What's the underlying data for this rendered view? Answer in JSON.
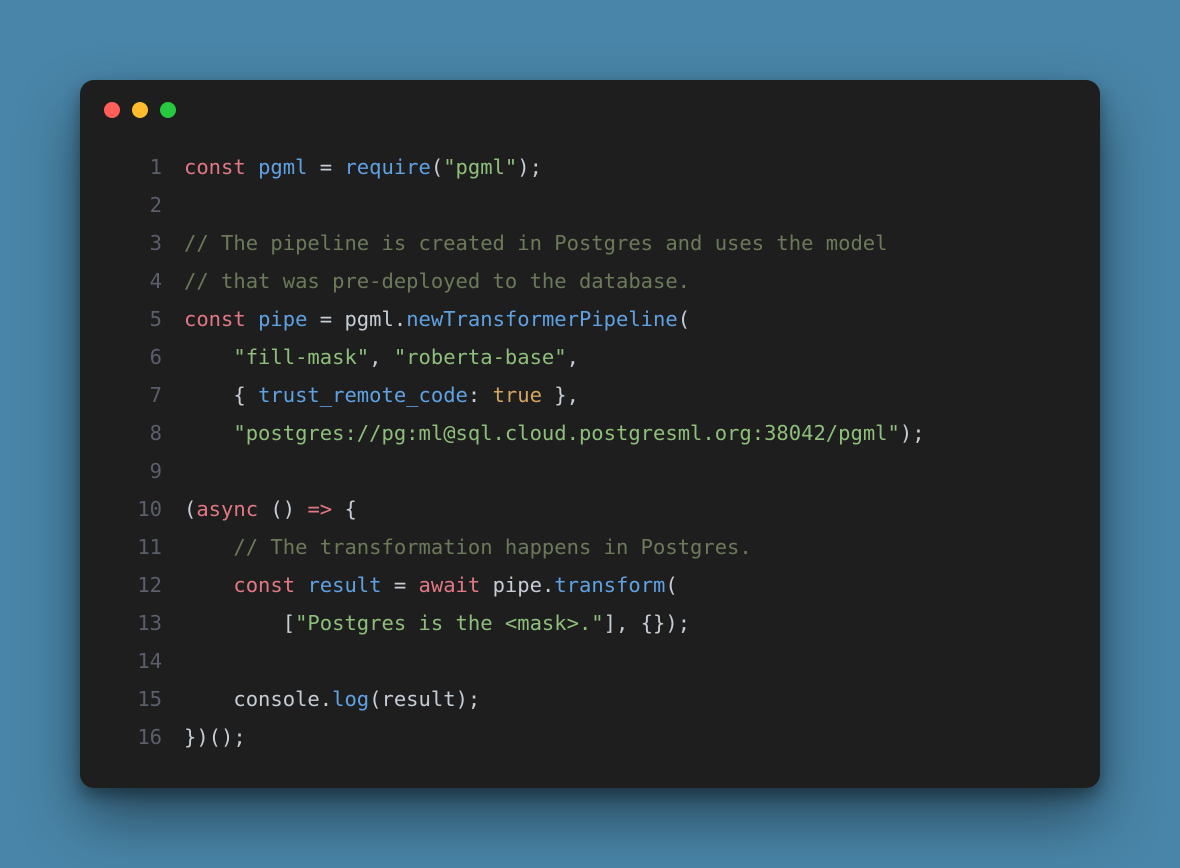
{
  "window": {
    "traffic_lights": [
      "close",
      "minimize",
      "zoom"
    ]
  },
  "code": {
    "lines": [
      {
        "n": "1",
        "tokens": [
          {
            "c": "tok-keyword",
            "t": "const"
          },
          {
            "c": "tok-default",
            "t": " "
          },
          {
            "c": "tok-ident",
            "t": "pgml"
          },
          {
            "c": "tok-default",
            "t": " "
          },
          {
            "c": "tok-punct",
            "t": "="
          },
          {
            "c": "tok-default",
            "t": " "
          },
          {
            "c": "tok-require",
            "t": "require"
          },
          {
            "c": "tok-punct",
            "t": "("
          },
          {
            "c": "tok-string",
            "t": "\"pgml\""
          },
          {
            "c": "tok-punct",
            "t": ");"
          }
        ]
      },
      {
        "n": "2",
        "tokens": []
      },
      {
        "n": "3",
        "tokens": [
          {
            "c": "tok-comment",
            "t": "// The pipeline is created in Postgres and uses the model"
          }
        ]
      },
      {
        "n": "4",
        "tokens": [
          {
            "c": "tok-comment",
            "t": "// that was pre-deployed to the database."
          }
        ]
      },
      {
        "n": "5",
        "tokens": [
          {
            "c": "tok-keyword",
            "t": "const"
          },
          {
            "c": "tok-default",
            "t": " "
          },
          {
            "c": "tok-ident",
            "t": "pipe"
          },
          {
            "c": "tok-default",
            "t": " "
          },
          {
            "c": "tok-punct",
            "t": "="
          },
          {
            "c": "tok-default",
            "t": " "
          },
          {
            "c": "tok-default",
            "t": "pgml"
          },
          {
            "c": "tok-punct",
            "t": "."
          },
          {
            "c": "tok-method",
            "t": "newTransformerPipeline"
          },
          {
            "c": "tok-punct",
            "t": "("
          }
        ]
      },
      {
        "n": "6",
        "tokens": [
          {
            "c": "tok-default",
            "t": "    "
          },
          {
            "c": "tok-string",
            "t": "\"fill-mask\""
          },
          {
            "c": "tok-punct",
            "t": ", "
          },
          {
            "c": "tok-string",
            "t": "\"roberta-base\""
          },
          {
            "c": "tok-punct",
            "t": ","
          }
        ]
      },
      {
        "n": "7",
        "tokens": [
          {
            "c": "tok-default",
            "t": "    "
          },
          {
            "c": "tok-punct",
            "t": "{ "
          },
          {
            "c": "tok-prop",
            "t": "trust_remote_code"
          },
          {
            "c": "tok-punct",
            "t": ": "
          },
          {
            "c": "tok-bool",
            "t": "true"
          },
          {
            "c": "tok-punct",
            "t": " },"
          }
        ]
      },
      {
        "n": "8",
        "tokens": [
          {
            "c": "tok-default",
            "t": "    "
          },
          {
            "c": "tok-string",
            "t": "\"postgres://pg:ml@sql.cloud.postgresml.org:38042/pgml\""
          },
          {
            "c": "tok-punct",
            "t": ");"
          }
        ]
      },
      {
        "n": "9",
        "tokens": []
      },
      {
        "n": "10",
        "tokens": [
          {
            "c": "tok-punct",
            "t": "("
          },
          {
            "c": "tok-keyword",
            "t": "async"
          },
          {
            "c": "tok-default",
            "t": " "
          },
          {
            "c": "tok-punct",
            "t": "() "
          },
          {
            "c": "tok-keyword",
            "t": "=>"
          },
          {
            "c": "tok-punct",
            "t": " {"
          }
        ]
      },
      {
        "n": "11",
        "tokens": [
          {
            "c": "tok-default",
            "t": "    "
          },
          {
            "c": "tok-comment",
            "t": "// The transformation happens in Postgres."
          }
        ]
      },
      {
        "n": "12",
        "tokens": [
          {
            "c": "tok-default",
            "t": "    "
          },
          {
            "c": "tok-keyword",
            "t": "const"
          },
          {
            "c": "tok-default",
            "t": " "
          },
          {
            "c": "tok-ident",
            "t": "result"
          },
          {
            "c": "tok-default",
            "t": " "
          },
          {
            "c": "tok-punct",
            "t": "="
          },
          {
            "c": "tok-default",
            "t": " "
          },
          {
            "c": "tok-keyword",
            "t": "await"
          },
          {
            "c": "tok-default",
            "t": " "
          },
          {
            "c": "tok-default",
            "t": "pipe"
          },
          {
            "c": "tok-punct",
            "t": "."
          },
          {
            "c": "tok-method",
            "t": "transform"
          },
          {
            "c": "tok-punct",
            "t": "("
          }
        ]
      },
      {
        "n": "13",
        "tokens": [
          {
            "c": "tok-default",
            "t": "        "
          },
          {
            "c": "tok-punct",
            "t": "["
          },
          {
            "c": "tok-string",
            "t": "\"Postgres is the <mask>.\""
          },
          {
            "c": "tok-punct",
            "t": "], {});"
          }
        ]
      },
      {
        "n": "14",
        "tokens": []
      },
      {
        "n": "15",
        "tokens": [
          {
            "c": "tok-default",
            "t": "    "
          },
          {
            "c": "tok-default",
            "t": "console"
          },
          {
            "c": "tok-punct",
            "t": "."
          },
          {
            "c": "tok-method",
            "t": "log"
          },
          {
            "c": "tok-punct",
            "t": "("
          },
          {
            "c": "tok-default",
            "t": "result"
          },
          {
            "c": "tok-punct",
            "t": ");"
          }
        ]
      },
      {
        "n": "16",
        "tokens": [
          {
            "c": "tok-punct",
            "t": "})();"
          }
        ]
      }
    ]
  }
}
